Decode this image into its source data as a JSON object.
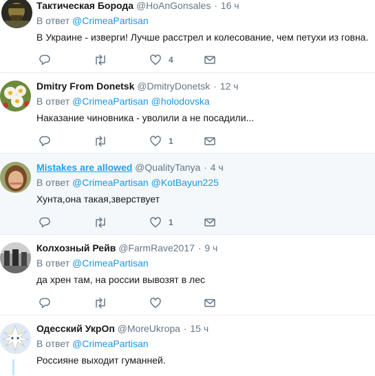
{
  "tweets": [
    {
      "name": "Тактическая Борода",
      "handle": "@HoAnGonsales",
      "time": "16 ч",
      "reply_prefix": "В ответ",
      "mentions": [
        "@CrimeaPartisan"
      ],
      "text": "В Украине - изверги! Лучше расстрел и колесование, чем петухи из говна.",
      "likes": "4"
    },
    {
      "name": "Dmitry From Donetsk",
      "handle": "@DmitryDonetsk",
      "time": "12 ч",
      "reply_prefix": "В ответ",
      "mentions": [
        "@CrimeaPartisan",
        "@holodovska"
      ],
      "text": "Наказание чиновника - уволили а не посадили...",
      "likes": "1"
    },
    {
      "name": "Mistakes are allowed",
      "handle": "@QualityTanya",
      "time": "4 ч",
      "reply_prefix": "В ответ",
      "mentions": [
        "@CrimeaPartisan",
        "@KotBayun225"
      ],
      "text": "Хунта,она такая,зверствует",
      "likes": "1"
    },
    {
      "name": "Колхозный Рейв",
      "handle": "@FarmRave2017",
      "time": "9 ч",
      "reply_prefix": "В ответ",
      "mentions": [
        "@CrimeaPartisan"
      ],
      "text": "да хрен там, на россии вывозят в лес",
      "likes": ""
    },
    {
      "name": "Одесский УкрОп",
      "handle": "@MoreUkropa",
      "time": "15 ч",
      "reply_prefix": "В ответ",
      "mentions": [
        "@CrimeaPartisan"
      ],
      "text": "Россияне выходит гуманней.",
      "likes": ""
    }
  ],
  "separator": "·",
  "icons": [
    "reply-icon",
    "retweet-icon",
    "like-icon",
    "direct-message-icon"
  ],
  "colors": {
    "link": "#1da1f2",
    "mention": "#1b95e0",
    "muted": "#657786",
    "highlight_bg": "#f5f8fa",
    "divider": "#e6ecf0"
  }
}
